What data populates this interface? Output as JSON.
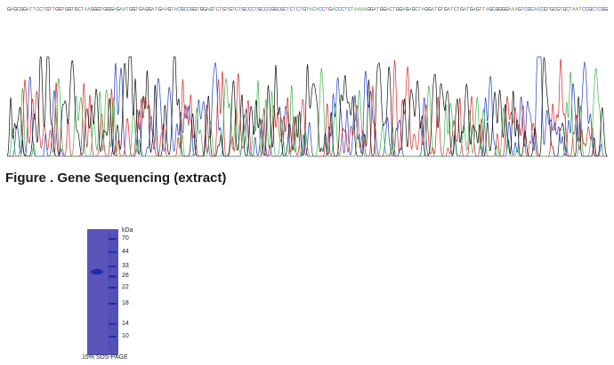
{
  "sequence": {
    "bases": "GAGCGGATTCCTGTTGGTGGTGCTAAGGGTGGGAGAATGGTGAGGATGAAGTACGCCGGTGGAGTCTGTGTCTGCCCTGCCCGGCGCTCTCTGTACACCTGACCCTCTAAAAGGATGGACTGGAGAGCTAGGATGTGATCTGATGAGTTAGCGGGGAAAGTCGCACCGTGCGTGCTAATCCGCTCGG",
    "colors": {
      "A": "#3cb44b",
      "C": "#1f3fbf",
      "G": "#222222",
      "T": "#d62728"
    }
  },
  "figure_title": "Figure . Gene Sequencing (extract)",
  "gel": {
    "unit": "kDa",
    "markers": [
      "70",
      "44",
      "33",
      "26",
      "22",
      "18",
      "14",
      "10"
    ],
    "caption": "15% SDS-PAGE",
    "background_color": "#5a55b8",
    "band_color": "#1d2fb0"
  }
}
